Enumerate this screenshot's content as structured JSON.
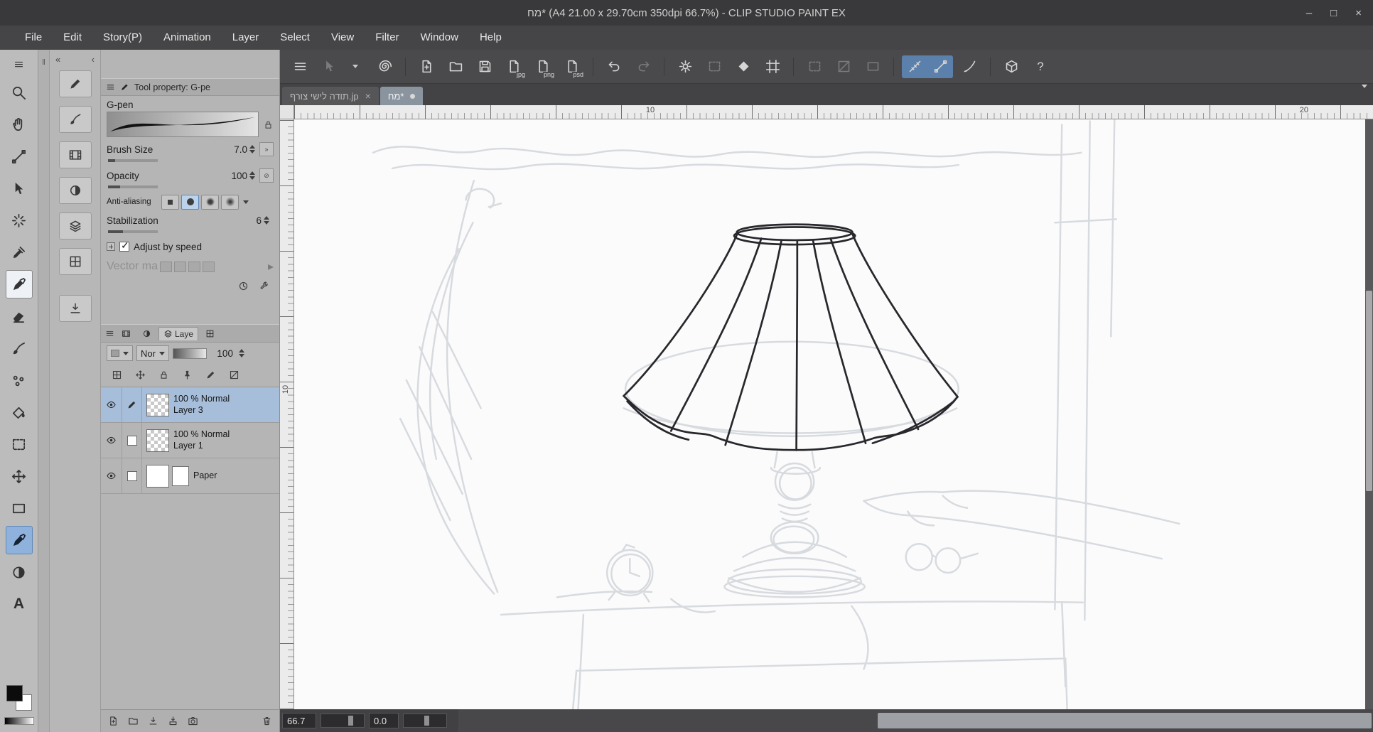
{
  "window": {
    "title": "מח* (A4 21.00 x 29.70cm 350dpi 66.7%)  - CLIP STUDIO PAINT EX",
    "minimize": "–",
    "maximize": "□",
    "close": "×"
  },
  "menu": {
    "items": [
      "File",
      "Edit",
      "Story(P)",
      "Animation",
      "Layer",
      "Select",
      "View",
      "Filter",
      "Window",
      "Help"
    ]
  },
  "toolbar": {
    "jpg_label": "jpg",
    "png_label": "png",
    "psd_label": "psd",
    "help_label": "?"
  },
  "tabs": {
    "tab1_label": "תודה לישי צורף.jp",
    "tab1_close": "×",
    "tab2_label": "מח*"
  },
  "tools": {
    "text_label": "A"
  },
  "tool_property": {
    "header": "Tool property: G-pe",
    "tool_name": "G-pen",
    "brush_size_label": "Brush Size",
    "brush_size_value": "7.0",
    "opacity_label": "Opacity",
    "opacity_value": "100",
    "anti_aliasing_label": "Anti-aliasing",
    "stabilization_label": "Stabilization",
    "stabilization_value": "6",
    "adjust_by_speed_label": "Adjust by speed",
    "vector_label": "Vector ma"
  },
  "layer_panel": {
    "tab_label": "Laye",
    "blend_mode": "Nor",
    "opacity_value": "100",
    "layers": [
      {
        "info": "100 % Normal",
        "name": "Layer 3"
      },
      {
        "info": "100 % Normal",
        "name": "Layer 1"
      },
      {
        "info": "",
        "name": "Paper"
      }
    ]
  },
  "ruler": {
    "top_label_10": "10",
    "top_label_20": "20",
    "left_label_10": "10"
  },
  "status": {
    "zoom": "66.7",
    "rotation": "0.0"
  }
}
